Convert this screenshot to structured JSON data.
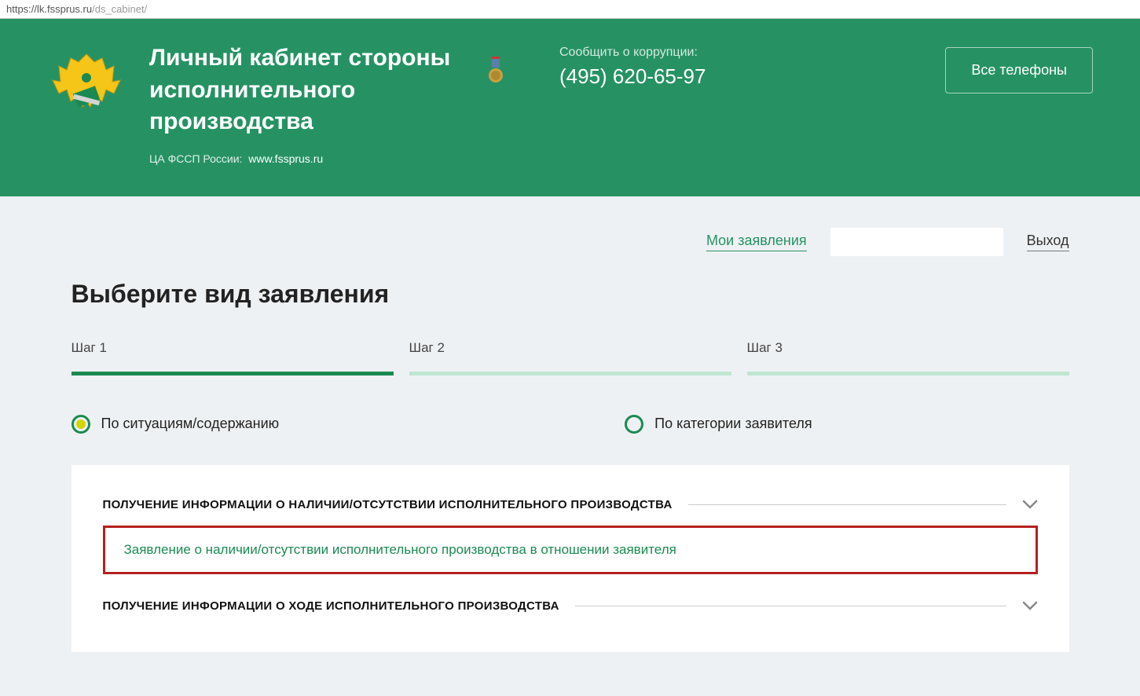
{
  "browser": {
    "url_protocol": "https://",
    "url_domain": "lk.fssprus.ru",
    "url_path": "/ds_cabinet/"
  },
  "header": {
    "title": "Личный кабинет стороны исполнительного производства",
    "subtitle_prefix": "ЦА ФССП России:",
    "subtitle_link": "www.fssprus.ru",
    "contact_label": "Сообщить о коррупции:",
    "contact_phone": "(495) 620-65-97",
    "all_phones_button": "Все телефоны"
  },
  "user_bar": {
    "my_applications": "Мои заявления",
    "logout": "Выход"
  },
  "page": {
    "heading": "Выберите вид заявления"
  },
  "steps": [
    {
      "label": "Шаг 1",
      "active": true
    },
    {
      "label": "Шаг 2",
      "active": false
    },
    {
      "label": "Шаг 3",
      "active": false
    }
  ],
  "radios": {
    "by_situation": "По ситуациям/содержанию",
    "by_category": "По категории заявителя"
  },
  "accordion": {
    "item1_title": "ПОЛУЧЕНИЕ ИНФОРМАЦИИ О НАЛИЧИИ/ОТСУТСТВИИ ИСПОЛНИТЕЛЬНОГО ПРОИЗВОДСТВА",
    "item1_link": "Заявление о наличии/отсутствии исполнительного производства в отношении заявителя",
    "item2_title": "ПОЛУЧЕНИЕ ИНФОРМАЦИИ О ХОДЕ ИСПОЛНИТЕЛЬНОГО ПРОИЗВОДСТВА"
  }
}
